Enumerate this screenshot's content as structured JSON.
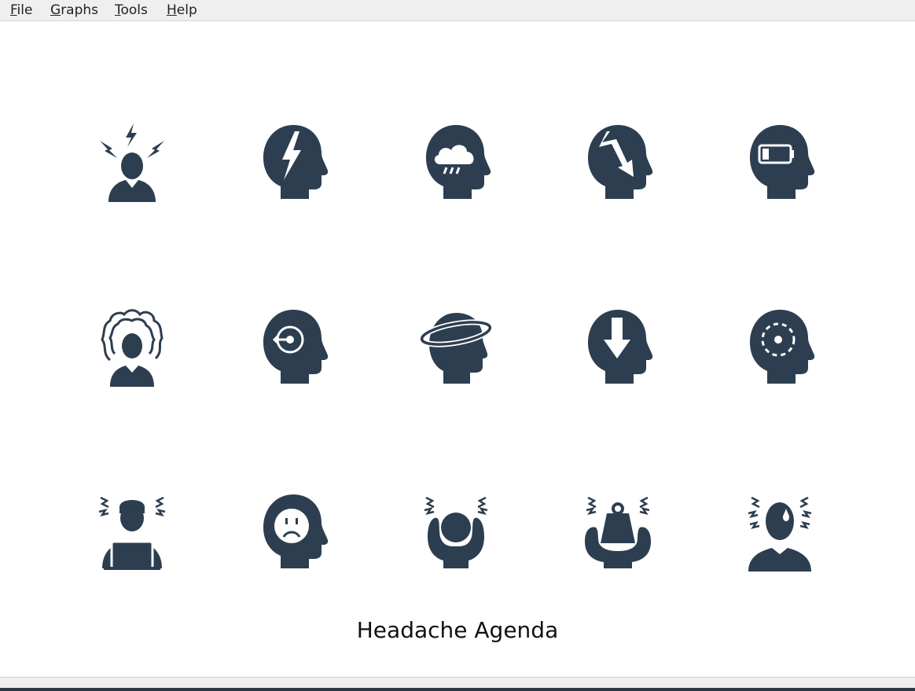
{
  "menu": {
    "file": {
      "mnemonic": "F",
      "rest": "ile"
    },
    "graphs": {
      "mnemonic": "G",
      "rest": "raphs"
    },
    "tools": {
      "mnemonic": "T",
      "rest": "ools"
    },
    "help": {
      "mnemonic": "H",
      "rest": "elp"
    }
  },
  "icon_color": "#2d3e50",
  "icons": [
    {
      "name": "stress-lightning-person-icon"
    },
    {
      "name": "head-lightning-icon"
    },
    {
      "name": "head-rain-cloud-icon"
    },
    {
      "name": "head-broken-arrow-icon"
    },
    {
      "name": "head-low-battery-icon"
    },
    {
      "name": "frazzled-hair-person-icon"
    },
    {
      "name": "head-target-icon"
    },
    {
      "name": "head-orbit-dizzy-icon"
    },
    {
      "name": "head-down-arrow-icon"
    },
    {
      "name": "head-dashed-circle-icon"
    },
    {
      "name": "stressed-laptop-worker-icon"
    },
    {
      "name": "head-sad-face-icon"
    },
    {
      "name": "person-holding-head-icon"
    },
    {
      "name": "person-holding-weight-icon"
    },
    {
      "name": "sweating-person-icon"
    }
  ],
  "caption": "Headache Agenda"
}
